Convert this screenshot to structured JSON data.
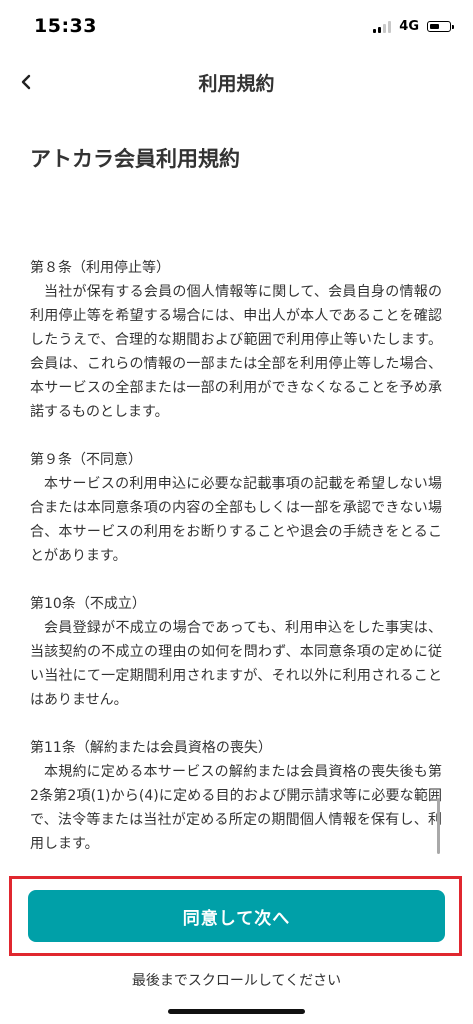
{
  "status_bar": {
    "time": "15:33",
    "network": "4G"
  },
  "nav": {
    "title": "利用規約"
  },
  "document": {
    "title": "アトカラ会員利用規約",
    "articles": [
      {
        "heading": "第８条（利用停止等）",
        "body": "当社が保有する会員の個人情報等に関して、会員自身の情報の利用停止等を希望する場合には、申出人が本人であることを確認したうえで、合理的な期間および範囲で利用停止等いたします。会員は、これらの情報の一部または全部を利用停止等した場合、本サービスの全部または一部の利用ができなくなることを予め承諾するものとします。"
      },
      {
        "heading": "第９条（不同意）",
        "body": "本サービスの利用申込に必要な記載事項の記載を希望しない場合または本同意条項の内容の全部もしくは一部を承認できない場合、本サービスの利用をお断りすることや退会の手続きをとることがあります。"
      },
      {
        "heading": "第10条（不成立）",
        "body": "会員登録が不成立の場合であっても、利用申込をした事実は、当該契約の不成立の理由の如何を問わず、本同意条項の定めに従い当社にて一定期間利用されますが、それ以外に利用されることはありません。"
      },
      {
        "heading": "第11条（解約または会員資格の喪失）",
        "body": "本規約に定める本サービスの解約または会員資格の喪失後も第2条第2項(1)から(4)に定める目的および開示請求等に必要な範囲で、法令等または当社が定める所定の期間個人情報を保有し、利用します。"
      }
    ]
  },
  "footer": {
    "agree_button": "同意して次へ",
    "scroll_hint": "最後までスクロールしてください",
    "accent_color": "#00a0a8",
    "highlight_color": "#e0272f"
  }
}
